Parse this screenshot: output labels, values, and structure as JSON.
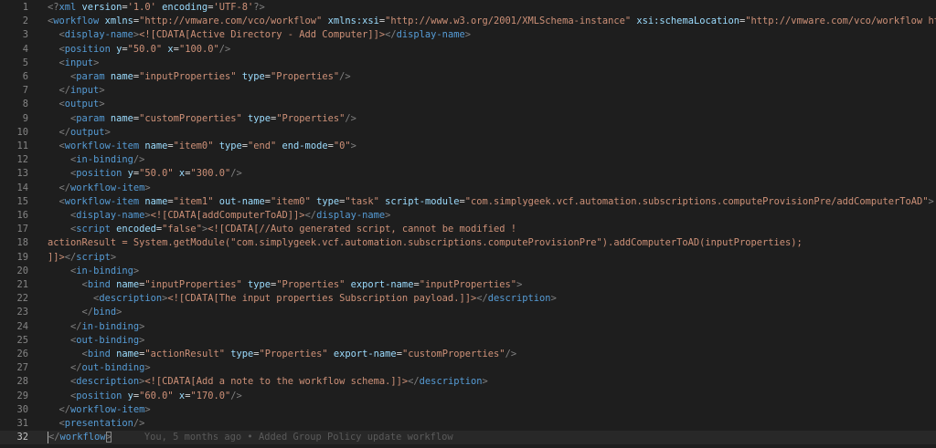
{
  "editor": {
    "lines": [
      {
        "n": "1",
        "tokens": [
          [
            "p",
            "<?"
          ],
          [
            "t",
            "xml"
          ],
          [
            "a",
            " version"
          ],
          [
            "x",
            "="
          ],
          [
            "s",
            "'1.0'"
          ],
          [
            "a",
            " encoding"
          ],
          [
            "x",
            "="
          ],
          [
            "s",
            "'UTF-8'"
          ],
          [
            "p",
            "?>"
          ]
        ]
      },
      {
        "n": "2",
        "tokens": [
          [
            "p",
            "<"
          ],
          [
            "t",
            "workflow"
          ],
          [
            "a",
            " xmlns"
          ],
          [
            "x",
            "="
          ],
          [
            "s",
            "\"http://vmware.com/vco/workflow\""
          ],
          [
            "a",
            " xmlns:xsi"
          ],
          [
            "x",
            "="
          ],
          [
            "s",
            "\"http://www.w3.org/2001/XMLSchema-instance\""
          ],
          [
            "a",
            " xsi:schemaLocation"
          ],
          [
            "x",
            "="
          ],
          [
            "s",
            "\"http://vmware.com/vco/workflow http:"
          ]
        ]
      },
      {
        "n": "3",
        "tokens": [
          [
            "x",
            "  "
          ],
          [
            "p",
            "<"
          ],
          [
            "t",
            "display-name"
          ],
          [
            "p",
            ">"
          ],
          [
            "c",
            "<![CDATA[Active Directory - Add Computer]]>"
          ],
          [
            "p",
            "</"
          ],
          [
            "t",
            "display-name"
          ],
          [
            "p",
            ">"
          ]
        ]
      },
      {
        "n": "4",
        "tokens": [
          [
            "x",
            "  "
          ],
          [
            "p",
            "<"
          ],
          [
            "t",
            "position"
          ],
          [
            "a",
            " y"
          ],
          [
            "x",
            "="
          ],
          [
            "s",
            "\"50.0\""
          ],
          [
            "a",
            " x"
          ],
          [
            "x",
            "="
          ],
          [
            "s",
            "\"100.0\""
          ],
          [
            "p",
            "/>"
          ]
        ]
      },
      {
        "n": "5",
        "tokens": [
          [
            "x",
            "  "
          ],
          [
            "p",
            "<"
          ],
          [
            "t",
            "input"
          ],
          [
            "p",
            ">"
          ]
        ]
      },
      {
        "n": "6",
        "tokens": [
          [
            "x",
            "    "
          ],
          [
            "p",
            "<"
          ],
          [
            "t",
            "param"
          ],
          [
            "a",
            " name"
          ],
          [
            "x",
            "="
          ],
          [
            "s",
            "\"inputProperties\""
          ],
          [
            "a",
            " type"
          ],
          [
            "x",
            "="
          ],
          [
            "s",
            "\"Properties\""
          ],
          [
            "p",
            "/>"
          ]
        ]
      },
      {
        "n": "7",
        "tokens": [
          [
            "x",
            "  "
          ],
          [
            "p",
            "</"
          ],
          [
            "t",
            "input"
          ],
          [
            "p",
            ">"
          ]
        ]
      },
      {
        "n": "8",
        "tokens": [
          [
            "x",
            "  "
          ],
          [
            "p",
            "<"
          ],
          [
            "t",
            "output"
          ],
          [
            "p",
            ">"
          ]
        ]
      },
      {
        "n": "9",
        "tokens": [
          [
            "x",
            "    "
          ],
          [
            "p",
            "<"
          ],
          [
            "t",
            "param"
          ],
          [
            "a",
            " name"
          ],
          [
            "x",
            "="
          ],
          [
            "s",
            "\"customProperties\""
          ],
          [
            "a",
            " type"
          ],
          [
            "x",
            "="
          ],
          [
            "s",
            "\"Properties\""
          ],
          [
            "p",
            "/>"
          ]
        ]
      },
      {
        "n": "10",
        "tokens": [
          [
            "x",
            "  "
          ],
          [
            "p",
            "</"
          ],
          [
            "t",
            "output"
          ],
          [
            "p",
            ">"
          ]
        ]
      },
      {
        "n": "11",
        "tokens": [
          [
            "x",
            "  "
          ],
          [
            "p",
            "<"
          ],
          [
            "t",
            "workflow-item"
          ],
          [
            "a",
            " name"
          ],
          [
            "x",
            "="
          ],
          [
            "s",
            "\"item0\""
          ],
          [
            "a",
            " type"
          ],
          [
            "x",
            "="
          ],
          [
            "s",
            "\"end\""
          ],
          [
            "a",
            " end-mode"
          ],
          [
            "x",
            "="
          ],
          [
            "s",
            "\"0\""
          ],
          [
            "p",
            ">"
          ]
        ]
      },
      {
        "n": "12",
        "tokens": [
          [
            "x",
            "    "
          ],
          [
            "p",
            "<"
          ],
          [
            "t",
            "in-binding"
          ],
          [
            "p",
            "/>"
          ]
        ]
      },
      {
        "n": "13",
        "tokens": [
          [
            "x",
            "    "
          ],
          [
            "p",
            "<"
          ],
          [
            "t",
            "position"
          ],
          [
            "a",
            " y"
          ],
          [
            "x",
            "="
          ],
          [
            "s",
            "\"50.0\""
          ],
          [
            "a",
            " x"
          ],
          [
            "x",
            "="
          ],
          [
            "s",
            "\"300.0\""
          ],
          [
            "p",
            "/>"
          ]
        ]
      },
      {
        "n": "14",
        "tokens": [
          [
            "x",
            "  "
          ],
          [
            "p",
            "</"
          ],
          [
            "t",
            "workflow-item"
          ],
          [
            "p",
            ">"
          ]
        ]
      },
      {
        "n": "15",
        "tokens": [
          [
            "x",
            "  "
          ],
          [
            "p",
            "<"
          ],
          [
            "t",
            "workflow-item"
          ],
          [
            "a",
            " name"
          ],
          [
            "x",
            "="
          ],
          [
            "s",
            "\"item1\""
          ],
          [
            "a",
            " out-name"
          ],
          [
            "x",
            "="
          ],
          [
            "s",
            "\"item0\""
          ],
          [
            "a",
            " type"
          ],
          [
            "x",
            "="
          ],
          [
            "s",
            "\"task\""
          ],
          [
            "a",
            " script-module"
          ],
          [
            "x",
            "="
          ],
          [
            "s",
            "\"com.simplygeek.vcf.automation.subscriptions.computeProvisionPre/addComputerToAD\""
          ],
          [
            "p",
            ">"
          ]
        ]
      },
      {
        "n": "16",
        "tokens": [
          [
            "x",
            "    "
          ],
          [
            "p",
            "<"
          ],
          [
            "t",
            "display-name"
          ],
          [
            "p",
            ">"
          ],
          [
            "c",
            "<![CDATA[addComputerToAD]]>"
          ],
          [
            "p",
            "</"
          ],
          [
            "t",
            "display-name"
          ],
          [
            "p",
            ">"
          ]
        ]
      },
      {
        "n": "17",
        "tokens": [
          [
            "x",
            "    "
          ],
          [
            "p",
            "<"
          ],
          [
            "t",
            "script"
          ],
          [
            "a",
            " encoded"
          ],
          [
            "x",
            "="
          ],
          [
            "s",
            "\"false\""
          ],
          [
            "p",
            ">"
          ],
          [
            "c",
            "<![CDATA[//Auto generated script, cannot be modified !"
          ]
        ]
      },
      {
        "n": "18",
        "tokens": [
          [
            "c",
            "actionResult = System.getModule(\"com.simplygeek.vcf.automation.subscriptions.computeProvisionPre\").addComputerToAD(inputProperties);"
          ]
        ]
      },
      {
        "n": "19",
        "tokens": [
          [
            "c",
            "]]>"
          ],
          [
            "p",
            "</"
          ],
          [
            "t",
            "script"
          ],
          [
            "p",
            ">"
          ]
        ]
      },
      {
        "n": "20",
        "tokens": [
          [
            "x",
            "    "
          ],
          [
            "p",
            "<"
          ],
          [
            "t",
            "in-binding"
          ],
          [
            "p",
            ">"
          ]
        ]
      },
      {
        "n": "21",
        "tokens": [
          [
            "x",
            "      "
          ],
          [
            "p",
            "<"
          ],
          [
            "t",
            "bind"
          ],
          [
            "a",
            " name"
          ],
          [
            "x",
            "="
          ],
          [
            "s",
            "\"inputProperties\""
          ],
          [
            "a",
            " type"
          ],
          [
            "x",
            "="
          ],
          [
            "s",
            "\"Properties\""
          ],
          [
            "a",
            " export-name"
          ],
          [
            "x",
            "="
          ],
          [
            "s",
            "\"inputProperties\""
          ],
          [
            "p",
            ">"
          ]
        ]
      },
      {
        "n": "22",
        "tokens": [
          [
            "x",
            "        "
          ],
          [
            "p",
            "<"
          ],
          [
            "t",
            "description"
          ],
          [
            "p",
            ">"
          ],
          [
            "c",
            "<![CDATA[The input properties Subscription payload.]]>"
          ],
          [
            "p",
            "</"
          ],
          [
            "t",
            "description"
          ],
          [
            "p",
            ">"
          ]
        ]
      },
      {
        "n": "23",
        "tokens": [
          [
            "x",
            "      "
          ],
          [
            "p",
            "</"
          ],
          [
            "t",
            "bind"
          ],
          [
            "p",
            ">"
          ]
        ]
      },
      {
        "n": "24",
        "tokens": [
          [
            "x",
            "    "
          ],
          [
            "p",
            "</"
          ],
          [
            "t",
            "in-binding"
          ],
          [
            "p",
            ">"
          ]
        ]
      },
      {
        "n": "25",
        "tokens": [
          [
            "x",
            "    "
          ],
          [
            "p",
            "<"
          ],
          [
            "t",
            "out-binding"
          ],
          [
            "p",
            ">"
          ]
        ]
      },
      {
        "n": "26",
        "tokens": [
          [
            "x",
            "      "
          ],
          [
            "p",
            "<"
          ],
          [
            "t",
            "bind"
          ],
          [
            "a",
            " name"
          ],
          [
            "x",
            "="
          ],
          [
            "s",
            "\"actionResult\""
          ],
          [
            "a",
            " type"
          ],
          [
            "x",
            "="
          ],
          [
            "s",
            "\"Properties\""
          ],
          [
            "a",
            " export-name"
          ],
          [
            "x",
            "="
          ],
          [
            "s",
            "\"customProperties\""
          ],
          [
            "p",
            "/>"
          ]
        ]
      },
      {
        "n": "27",
        "tokens": [
          [
            "x",
            "    "
          ],
          [
            "p",
            "</"
          ],
          [
            "t",
            "out-binding"
          ],
          [
            "p",
            ">"
          ]
        ]
      },
      {
        "n": "28",
        "tokens": [
          [
            "x",
            "    "
          ],
          [
            "p",
            "<"
          ],
          [
            "t",
            "description"
          ],
          [
            "p",
            ">"
          ],
          [
            "c",
            "<![CDATA[Add a note to the workflow schema.]]>"
          ],
          [
            "p",
            "</"
          ],
          [
            "t",
            "description"
          ],
          [
            "p",
            ">"
          ]
        ]
      },
      {
        "n": "29",
        "tokens": [
          [
            "x",
            "    "
          ],
          [
            "p",
            "<"
          ],
          [
            "t",
            "position"
          ],
          [
            "a",
            " y"
          ],
          [
            "x",
            "="
          ],
          [
            "s",
            "\"60.0\""
          ],
          [
            "a",
            " x"
          ],
          [
            "x",
            "="
          ],
          [
            "s",
            "\"170.0\""
          ],
          [
            "p",
            "/>"
          ]
        ]
      },
      {
        "n": "30",
        "tokens": [
          [
            "x",
            "  "
          ],
          [
            "p",
            "</"
          ],
          [
            "t",
            "workflow-item"
          ],
          [
            "p",
            ">"
          ]
        ]
      },
      {
        "n": "31",
        "tokens": [
          [
            "x",
            "  "
          ],
          [
            "p",
            "<"
          ],
          [
            "t",
            "presentation"
          ],
          [
            "p",
            "/>"
          ]
        ]
      },
      {
        "n": "32",
        "tokens": [
          [
            "p",
            "</"
          ],
          [
            "t",
            "workflow"
          ],
          [
            "p",
            ">"
          ]
        ],
        "current": true
      }
    ],
    "blame": "You, 5 months ago • Added Group Policy update workflow",
    "colors": {
      "background": "#1e1e1e",
      "tag": "#569cd6",
      "attribute": "#9cdcfe",
      "string": "#ce9178",
      "punctuation": "#808080",
      "line_number": "#858585"
    }
  }
}
